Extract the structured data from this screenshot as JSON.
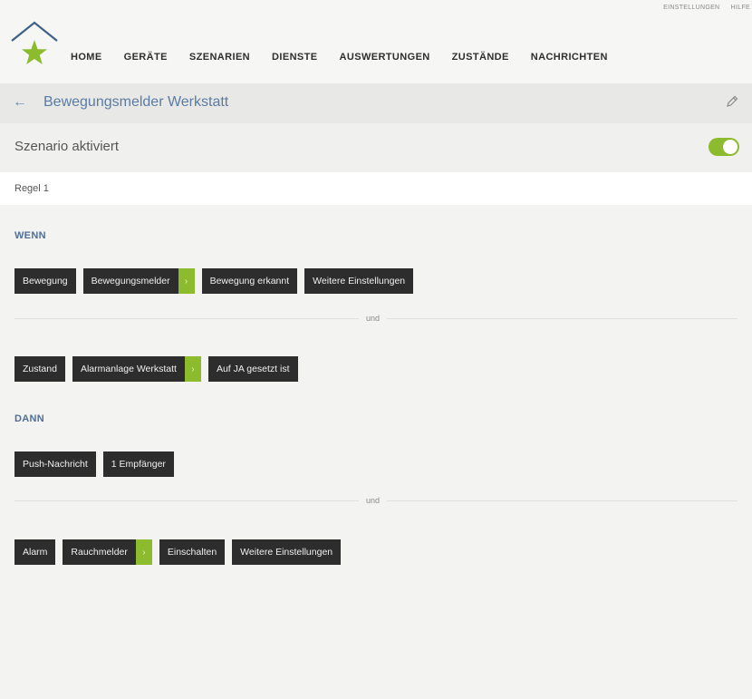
{
  "header": {
    "utility_links": [
      "EINSTELLUNGEN",
      "HILFE"
    ],
    "nav": [
      "HOME",
      "GERÄTE",
      "SZENARIEN",
      "DIENSTE",
      "AUSWERTUNGEN",
      "ZUSTÄNDE",
      "NACHRICHTEN"
    ]
  },
  "title_bar": {
    "back_icon": "arrow-left-icon",
    "title": "Bewegungsmelder Werkstatt",
    "edit_icon": "pencil-icon"
  },
  "scenario": {
    "label": "Szenario aktiviert",
    "enabled": true
  },
  "rule": {
    "label": "Regel 1"
  },
  "wenn": {
    "label": "WENN",
    "row1": [
      {
        "text": "Bewegung"
      },
      {
        "text": "Bewegungsmelder",
        "arrow": "›"
      },
      {
        "text": "Bewegung erkannt"
      },
      {
        "text": "Weitere Einstellungen"
      }
    ],
    "connector": "und",
    "row2": [
      {
        "text": "Zustand"
      },
      {
        "text": "Alarmanlage Werkstatt",
        "arrow": "›"
      },
      {
        "text": "Auf JA gesetzt ist"
      }
    ]
  },
  "dann": {
    "label": "DANN",
    "row1": [
      {
        "text": "Push-Nachricht"
      },
      {
        "text": "1 Empfänger"
      }
    ],
    "connector": "und",
    "row2": [
      {
        "text": "Alarm"
      },
      {
        "text": "Rauchmelder",
        "arrow": "›"
      },
      {
        "text": "Einschalten"
      },
      {
        "text": "Weitere Einstellungen"
      }
    ]
  },
  "colors": {
    "accent_green": "#8cbb2e",
    "title_blue": "#5a7ba3",
    "chip_dark": "#2d2d2d"
  }
}
